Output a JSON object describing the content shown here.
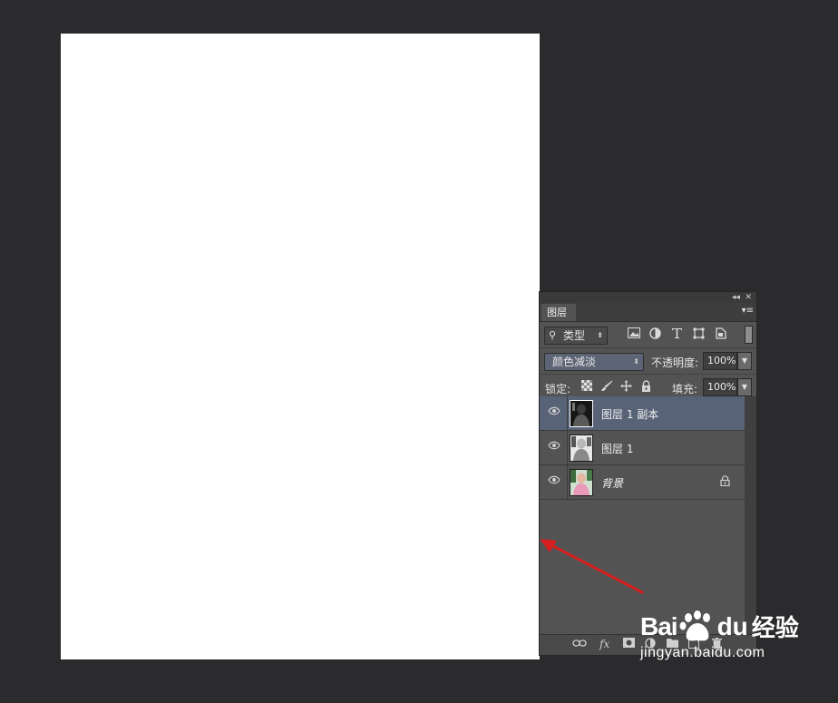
{
  "panel": {
    "collapse_icon": "◂◂",
    "close_icon": "✕",
    "tab_label": "图层",
    "menu_icon": "▾≡"
  },
  "filter": {
    "search_icon": "⚲",
    "kind_label": "类型",
    "kind_arrow": "⬍",
    "icons": [
      "image-filter-icon",
      "adjustment-filter-icon",
      "type-filter-icon",
      "shape-filter-icon",
      "smart-object-filter-icon"
    ]
  },
  "blend": {
    "mode": "颜色减淡",
    "opacity_label": "不透明度:",
    "opacity_value": "100%"
  },
  "lock": {
    "label": "锁定:",
    "fill_label": "填充:",
    "fill_value": "100%"
  },
  "layers": [
    {
      "name": "图层 1 副本",
      "selected": true,
      "italic": false,
      "locked": false
    },
    {
      "name": "图层 1",
      "selected": false,
      "italic": false,
      "locked": false
    },
    {
      "name": "背景",
      "selected": false,
      "italic": true,
      "locked": true
    }
  ],
  "footer": {
    "fx_label": "fx"
  },
  "watermark": {
    "brand_a": "Bai",
    "brand_b": "du",
    "brand_c": "经验",
    "url": "jingyan.baidu.com"
  },
  "colors": {
    "annotation_arrow": "#d62020",
    "selected_layer": "#586377"
  }
}
